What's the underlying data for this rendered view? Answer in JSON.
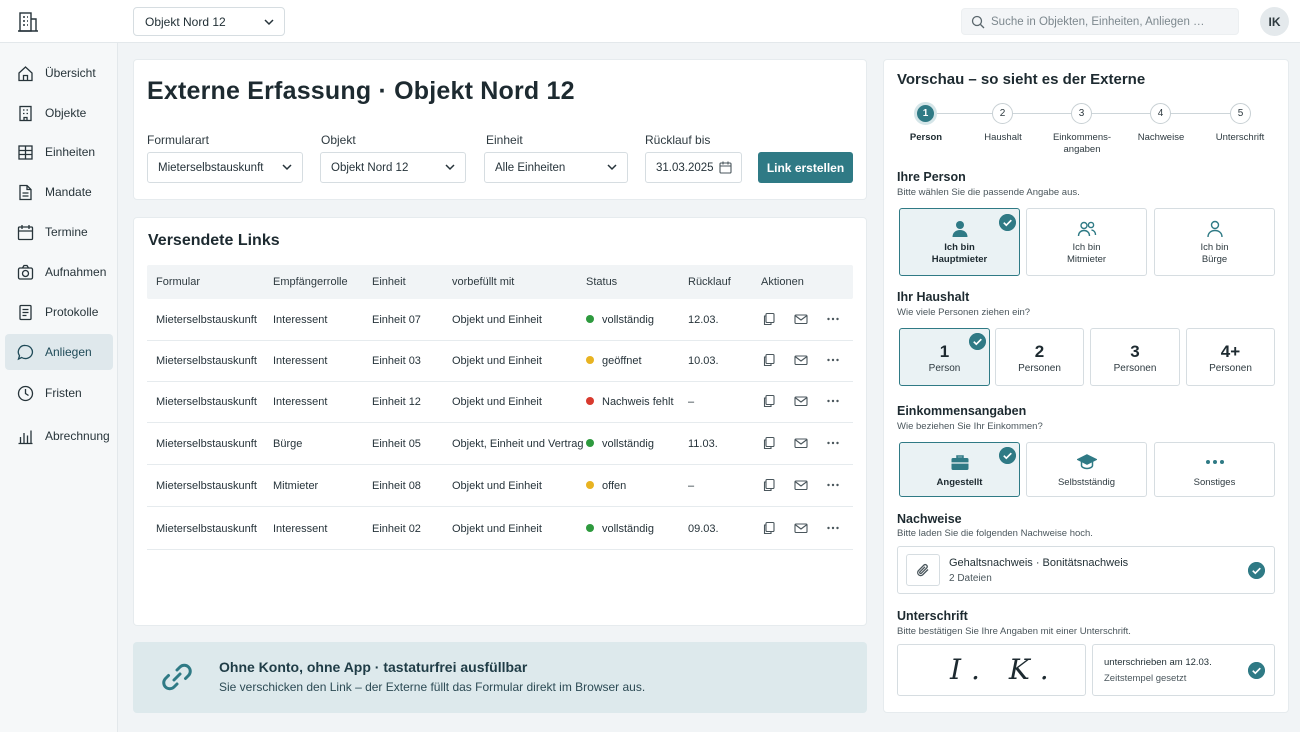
{
  "header": {
    "object_select": "Objekt Nord 12",
    "search_placeholder": "Suche in Objekten, Einheiten, Anliegen …",
    "user_initials": "IK"
  },
  "sidebar": {
    "items": [
      {
        "label": "Übersicht",
        "icon": "home-icon"
      },
      {
        "label": "Objekte",
        "icon": "building-icon"
      },
      {
        "label": "Einheiten",
        "icon": "units-icon"
      },
      {
        "label": "Mandate",
        "icon": "document-icon"
      },
      {
        "label": "Termine",
        "icon": "calendar-icon"
      },
      {
        "label": "Aufnahmen",
        "icon": "camera-icon"
      },
      {
        "label": "Protokolle",
        "icon": "protocol-icon"
      },
      {
        "label": "Anliegen",
        "icon": "chat-icon",
        "active": true
      },
      {
        "label": "Fristen",
        "icon": "clock-icon"
      },
      {
        "label": "Abrechnung",
        "icon": "chart-icon"
      }
    ]
  },
  "form": {
    "title": "Externe Erfassung · Objekt Nord 12",
    "formular_label": "Formularart",
    "formular_value": "Mieterselbstauskunft",
    "objekt_label": "Objekt",
    "objekt_value": "Objekt Nord 12",
    "einheit_label": "Einheit",
    "einheit_value": "Alle Einheiten",
    "ruecklauf_label": "Rücklauf bis",
    "ruecklauf_value": "31.03.2025",
    "create_button": "Link erstellen"
  },
  "links": {
    "title": "Versendete Links",
    "columns": [
      "Formular",
      "Empfängerrolle",
      "Einheit",
      "vorbefüllt mit",
      "Status",
      "Rücklauf",
      "Aktionen"
    ],
    "rows": [
      {
        "formular": "Mieterselbstauskunft",
        "rolle": "Interessent",
        "einheit": "Einheit 07",
        "vorbefuellt": "Objekt und Einheit",
        "status": "vollständig",
        "status_color": "#2e9a3e",
        "ruecklauf": "12.03."
      },
      {
        "formular": "Mieterselbstauskunft",
        "rolle": "Interessent",
        "einheit": "Einheit 03",
        "vorbefuellt": "Objekt und Einheit",
        "status": "geöffnet",
        "status_color": "#e8b321",
        "ruecklauf": "10.03."
      },
      {
        "formular": "Mieterselbstauskunft",
        "rolle": "Interessent",
        "einheit": "Einheit 12",
        "vorbefuellt": "Objekt und Einheit",
        "status": "Nachweis fehlt",
        "status_color": "#d83a2e",
        "ruecklauf": "–"
      },
      {
        "formular": "Mieterselbstauskunft",
        "rolle": "Bürge",
        "einheit": "Einheit 05",
        "vorbefuellt": "Objekt, Einheit und Vertrag",
        "status": "vollständig",
        "status_color": "#2e9a3e",
        "ruecklauf": "11.03."
      },
      {
        "formular": "Mieterselbstauskunft",
        "rolle": "Mitmieter",
        "einheit": "Einheit 08",
        "vorbefuellt": "Objekt und Einheit",
        "status": "offen",
        "status_color": "#e8b321",
        "ruecklauf": "–"
      },
      {
        "formular": "Mieterselbstauskunft",
        "rolle": "Interessent",
        "einheit": "Einheit 02",
        "vorbefuellt": "Objekt und Einheit",
        "status": "vollständig",
        "status_color": "#2e9a3e",
        "ruecklauf": "09.03."
      }
    ]
  },
  "banner": {
    "title": "Ohne Konto, ohne App · tastaturfrei ausfüllbar",
    "subtitle": "Sie verschicken den Link – der Externe füllt das Formular direkt im Browser aus."
  },
  "preview": {
    "title": "Vorschau – so sieht es der Externe",
    "steps": [
      {
        "num": "1",
        "label": "Person",
        "active": true
      },
      {
        "num": "2",
        "label": "Haushalt"
      },
      {
        "num": "3",
        "label": "Einkommens-\nangaben"
      },
      {
        "num": "4",
        "label": "Nachweise"
      },
      {
        "num": "5",
        "label": "Unterschrift"
      }
    ],
    "person": {
      "title": "Ihre Person",
      "subtitle": "Bitte wählen Sie die passende Angabe aus.",
      "options": [
        "Ich bin\nHauptmieter",
        "Ich bin\nMitmieter",
        "Ich bin\nBürge"
      ]
    },
    "haushalt": {
      "title": "Ihr Haushalt",
      "subtitle": "Wie viele Personen ziehen ein?",
      "options": [
        {
          "num": "1",
          "label": "Person"
        },
        {
          "num": "2",
          "label": "Personen"
        },
        {
          "num": "3",
          "label": "Personen"
        },
        {
          "num": "4+",
          "label": "Personen"
        }
      ]
    },
    "einkommen": {
      "title": "Einkommensangaben",
      "subtitle": "Wie beziehen Sie Ihr Einkommen?",
      "options": [
        "Angestellt",
        "Selbstständig",
        "Sonstiges"
      ]
    },
    "nachweise": {
      "title": "Nachweise",
      "subtitle": "Bitte laden Sie die folgenden Nachweise hoch.",
      "file_name": "Gehaltsnachweis · Bonitätsnachweis",
      "file_count": "2 Dateien"
    },
    "unterschrift": {
      "title": "Unterschrift",
      "subtitle": "Bitte bestätigen Sie Ihre Angaben mit einer Unterschrift.",
      "signature": "I. K.",
      "signed_on": "unterschrieben am 12.03.",
      "timestamp": "Zeitstempel gesetzt"
    }
  },
  "colors": {
    "accent": "#2f7a85",
    "ok": "#2e9a3e",
    "warn": "#e8b321",
    "error": "#d83a2e"
  }
}
